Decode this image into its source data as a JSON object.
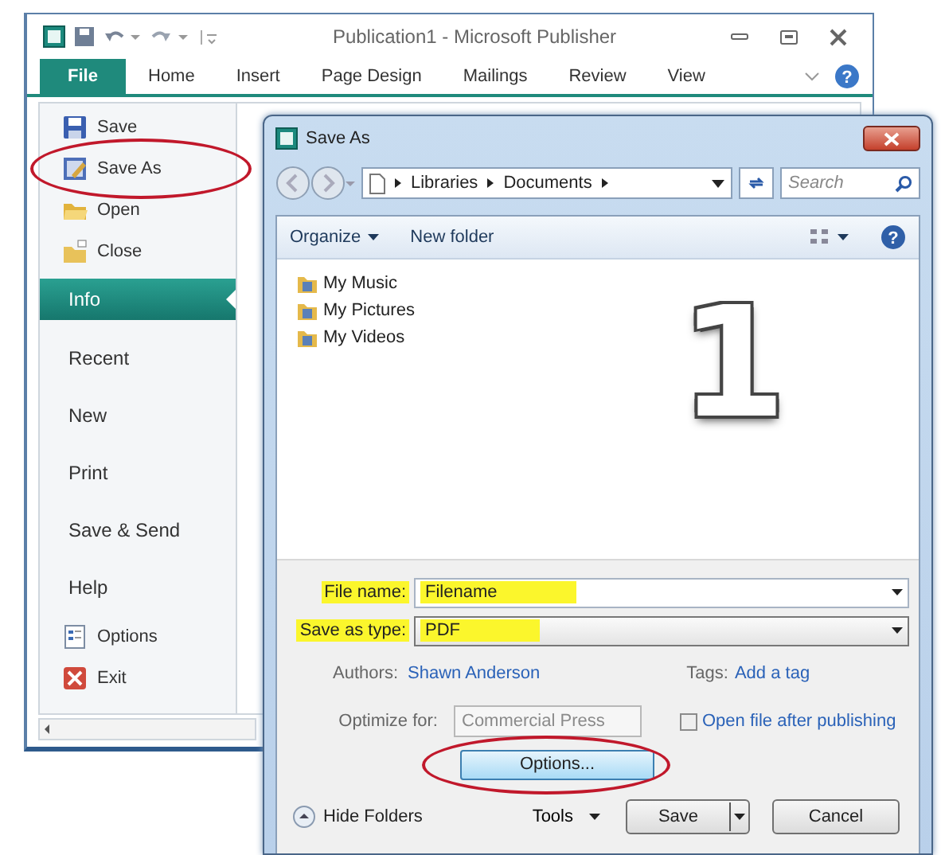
{
  "publisher_window": {
    "title": "Publication1 - Microsoft Publisher",
    "tabs": [
      {
        "label": "File",
        "selected": true
      },
      {
        "label": "Home",
        "selected": false
      },
      {
        "label": "Insert",
        "selected": false
      },
      {
        "label": "Page Design",
        "selected": false
      },
      {
        "label": "Mailings",
        "selected": false
      },
      {
        "label": "Review",
        "selected": false
      },
      {
        "label": "View",
        "selected": false
      }
    ],
    "help_glyph": "?",
    "backstage_menu": [
      {
        "label": "Save",
        "kind": "save",
        "selected": false,
        "circled": false
      },
      {
        "label": "Save As",
        "kind": "save-as",
        "selected": false,
        "circled": true
      },
      {
        "label": "Open",
        "kind": "open",
        "selected": false,
        "circled": false
      },
      {
        "label": "Close",
        "kind": "close",
        "selected": false,
        "circled": false
      },
      {
        "label": "Info",
        "kind": "page",
        "selected": true,
        "circled": false
      },
      {
        "label": "Recent",
        "kind": "page",
        "selected": false,
        "circled": false
      },
      {
        "label": "New",
        "kind": "page",
        "selected": false,
        "circled": false
      },
      {
        "label": "Print",
        "kind": "page",
        "selected": false,
        "circled": false
      },
      {
        "label": "Save & Send",
        "kind": "page",
        "selected": false,
        "circled": false
      },
      {
        "label": "Help",
        "kind": "page",
        "selected": false,
        "circled": false
      },
      {
        "label": "Options",
        "kind": "options",
        "selected": false,
        "circled": false
      },
      {
        "label": "Exit",
        "kind": "exit",
        "selected": false,
        "circled": false
      }
    ]
  },
  "save_as_dialog": {
    "title": "Save As",
    "breadcrumb": [
      "Libraries",
      "Documents"
    ],
    "search": {
      "placeholder": "Search"
    },
    "organize_button": "Organize",
    "new_folder_button": "New folder",
    "help_glyph": "?",
    "folders": [
      {
        "name": "My Music"
      },
      {
        "name": "My Pictures"
      },
      {
        "name": "My Videos"
      }
    ],
    "step_number": "1",
    "file_name": {
      "label": "File name:",
      "value": "Filename",
      "highlighted": true
    },
    "save_as_type": {
      "label": "Save as type:",
      "value": "PDF",
      "highlighted": true
    },
    "authors": {
      "label": "Authors:",
      "value": "Shawn Anderson"
    },
    "tags": {
      "label": "Tags:",
      "value": "Add a tag"
    },
    "optimize_for": {
      "label": "Optimize for:",
      "value": "Commercial Press",
      "disabled": true
    },
    "open_after_publishing": {
      "label": "Open file after publishing",
      "checked": false
    },
    "options_button": {
      "label": "Options...",
      "circled": true
    },
    "hide_folders": "Hide Folders",
    "tools": "Tools",
    "save_button": "Save",
    "cancel_button": "Cancel"
  }
}
